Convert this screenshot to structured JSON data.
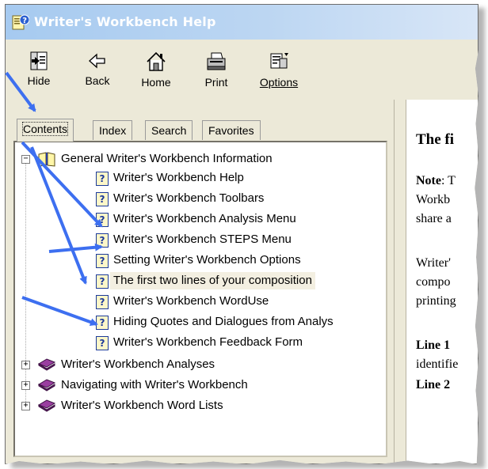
{
  "window": {
    "title": "Writer's Workbench Help"
  },
  "toolbar": [
    {
      "label": "Hide",
      "icon": "hide-icon"
    },
    {
      "label": "Back",
      "icon": "back-arrow-icon"
    },
    {
      "label": "Home",
      "icon": "home-icon"
    },
    {
      "label": "Print",
      "icon": "printer-icon"
    },
    {
      "label": "Options",
      "icon": "options-icon"
    }
  ],
  "tabs": [
    {
      "label": "Contents",
      "active": true
    },
    {
      "label": "Index",
      "active": false
    },
    {
      "label": "Search",
      "active": false
    },
    {
      "label": "Favorites",
      "active": false
    }
  ],
  "tree": {
    "root": {
      "label": "General Writer's Workbench Information",
      "expanded": true
    },
    "topics": [
      "Writer's Workbench Help",
      "Writer's Workbench Toolbars",
      "Writer's Workbench Analysis Menu",
      "Writer's Workbench STEPS Menu",
      "Setting Writer's Workbench Options",
      "The first two lines of your composition",
      "Writer's Workbench WordUse",
      "Hiding Quotes and Dialogues from Analys",
      "Writer's Workbench Feedback Form"
    ],
    "selected_index": 5,
    "collapsed_books": [
      "Writer's Workbench Analyses",
      "Navigating with Writer's Workbench",
      "Writer's Workbench Word Lists"
    ]
  },
  "content": {
    "heading": "The fi",
    "note_label": "Note",
    "note_line1": ": T",
    "note_line2": "Workb",
    "note_line3": "share a",
    "para_line1": "Writer'",
    "para_line2": "compo",
    "para_line3": "printing",
    "line1_label": "Line 1",
    "line1_text": "identifie",
    "line2_label": "Line 2"
  },
  "colors": {
    "arrow": "#3d6ff0",
    "title_bar": "#a6caf0",
    "book_closed": "#7a2a7f"
  }
}
